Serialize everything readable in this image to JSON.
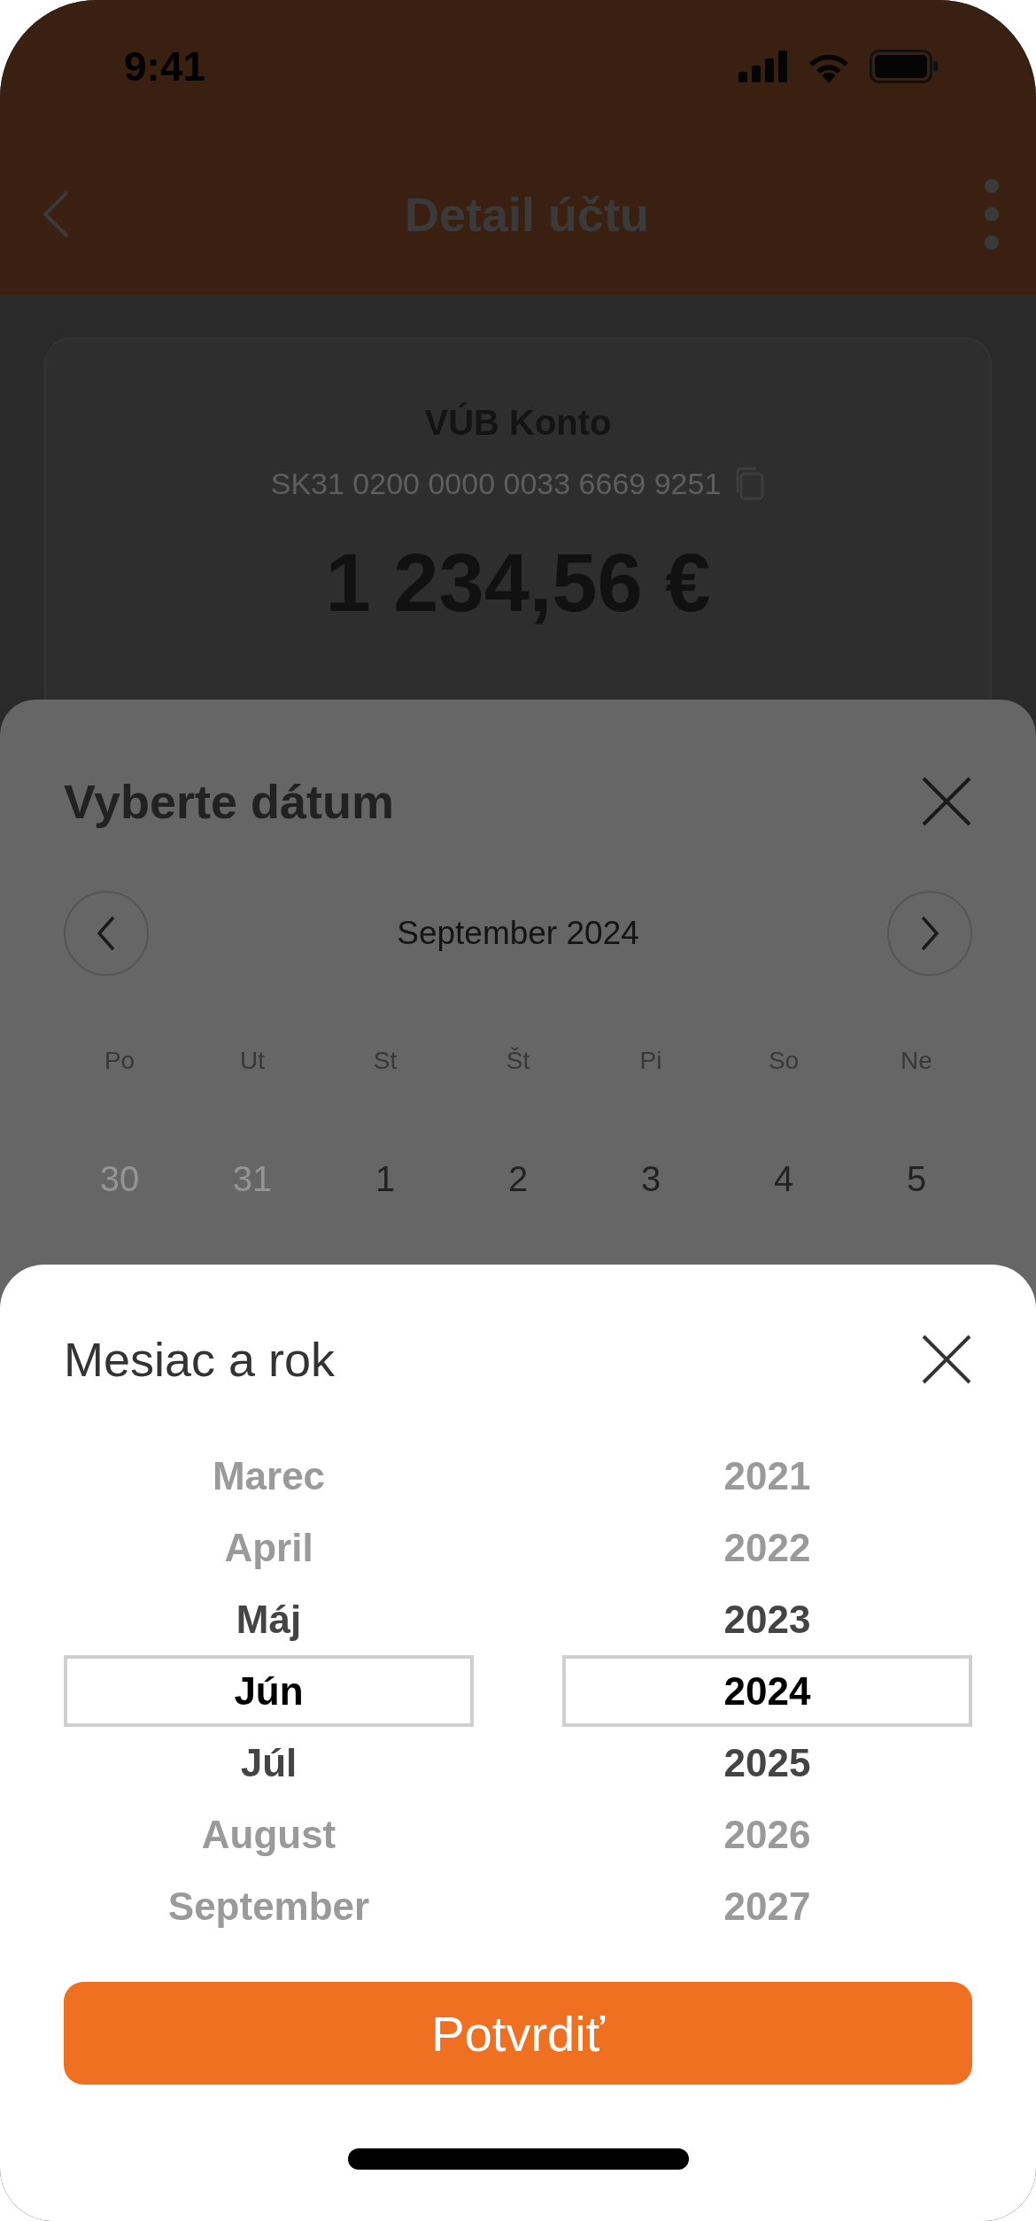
{
  "status_bar": {
    "time": "9:41"
  },
  "header": {
    "title": "Detail účtu"
  },
  "account": {
    "name": "VÚB Konto",
    "iban": "SK31 0200 0000 0033 6669 9251",
    "balance": "1 234,56 €"
  },
  "date_sheet": {
    "title": "Vyberte dátum",
    "month_label": "September 2024",
    "weekdays": [
      "Po",
      "Ut",
      "St",
      "Št",
      "Pi",
      "So",
      "Ne"
    ],
    "days": [
      {
        "label": "30",
        "outside_month": true
      },
      {
        "label": "31",
        "outside_month": true
      },
      {
        "label": "1",
        "outside_month": false
      },
      {
        "label": "2",
        "outside_month": false
      },
      {
        "label": "3",
        "outside_month": false
      },
      {
        "label": "4",
        "outside_month": false
      },
      {
        "label": "5",
        "outside_month": false
      }
    ]
  },
  "month_year_sheet": {
    "title": "Mesiac a rok",
    "months": [
      {
        "label": "Marec",
        "selected": false
      },
      {
        "label": "April",
        "selected": false
      },
      {
        "label": "Máj",
        "selected": false
      },
      {
        "label": "Jún",
        "selected": true
      },
      {
        "label": "Júl",
        "selected": false
      },
      {
        "label": "August",
        "selected": false
      },
      {
        "label": "September",
        "selected": false
      }
    ],
    "years": [
      {
        "label": "2021",
        "selected": false
      },
      {
        "label": "2022",
        "selected": false
      },
      {
        "label": "2023",
        "selected": false
      },
      {
        "label": "2024",
        "selected": true
      },
      {
        "label": "2025",
        "selected": false
      },
      {
        "label": "2026",
        "selected": false
      },
      {
        "label": "2027",
        "selected": false
      }
    ],
    "confirm_button": "Potvrdiť"
  }
}
